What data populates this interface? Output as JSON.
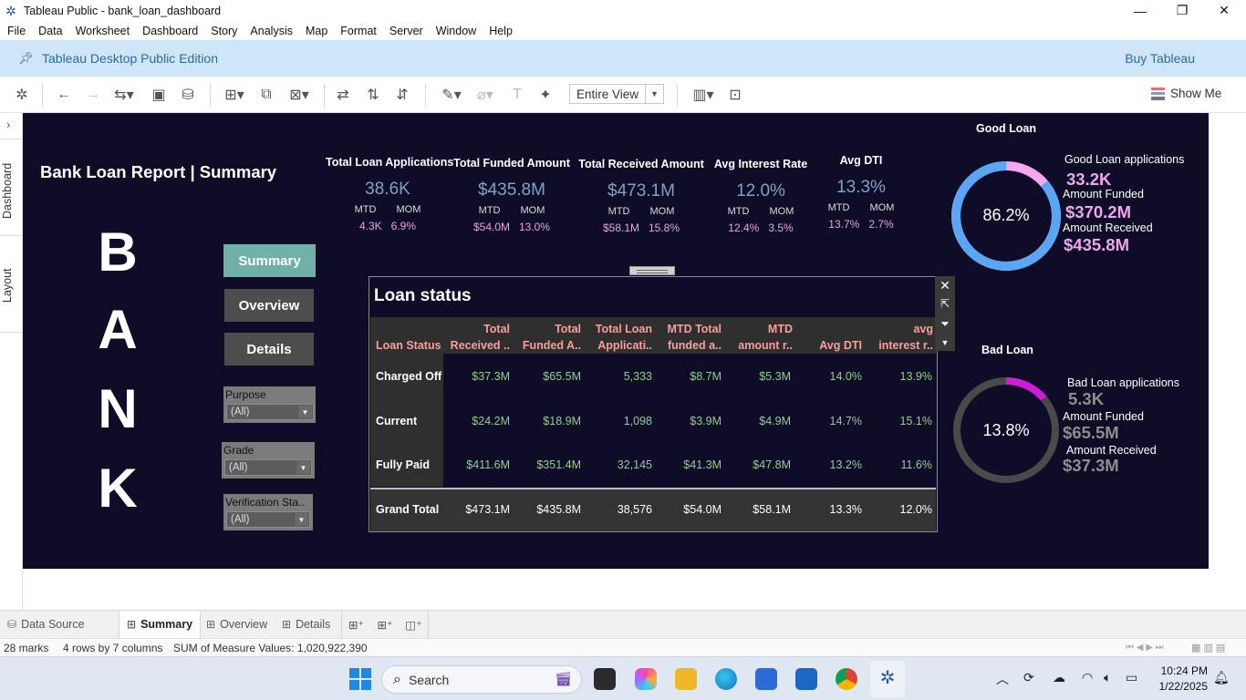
{
  "window": {
    "title": "Tableau Public - bank_loan_dashboard",
    "minimize_icon": "minimize-icon",
    "restore_icon": "restore-icon",
    "close_icon": "close-icon"
  },
  "menu": [
    "File",
    "Data",
    "Worksheet",
    "Dashboard",
    "Story",
    "Analysis",
    "Map",
    "Format",
    "Server",
    "Window",
    "Help"
  ],
  "banner": {
    "text": "Tableau Desktop Public Edition",
    "buy_label": "Buy Tableau"
  },
  "toolbar": {
    "view_select": "Entire View",
    "show_me": "Show Me"
  },
  "side": {
    "dashboard_label": "Dashboard",
    "layout_label": "Layout"
  },
  "dashboard": {
    "title": "Bank Loan Report | Summary",
    "bank_letters": [
      "B",
      "A",
      "N",
      "K"
    ],
    "nav": {
      "summary": "Summary",
      "overview": "Overview",
      "details": "Details"
    },
    "filters": [
      {
        "label": "Purpose",
        "value": "(All)"
      },
      {
        "label": "Grade",
        "value": "(All)"
      },
      {
        "label": "Verification Sta..",
        "value": "(All)"
      }
    ],
    "kpis": [
      {
        "title": "Total Loan Applications",
        "value": "38.6K",
        "mtd_label": "MTD",
        "mom_label": "MOM",
        "mtd": "4.3K",
        "mom": "6.9%"
      },
      {
        "title": "Total Funded Amount",
        "value": "$435.8M",
        "mtd_label": "MTD",
        "mom_label": "MOM",
        "mtd": "$54.0M",
        "mom": "13.0%"
      },
      {
        "title": "Total Received Amount",
        "value": "$473.1M",
        "mtd_label": "MTD",
        "mom_label": "MOM",
        "mtd": "$58.1M",
        "mom": "15.8%"
      },
      {
        "title": "Avg Interest Rate",
        "value": "12.0%",
        "mtd_label": "MTD",
        "mom_label": "MOM",
        "mtd": "12.4%",
        "mom": "3.5%"
      },
      {
        "title": "Avg DTI",
        "value": "13.3%",
        "mtd_label": "MTD",
        "mom_label": "MOM",
        "mtd": "13.7%",
        "mom": "2.7%"
      }
    ],
    "good_loan": {
      "heading": "Good Loan",
      "percent": "86.2%",
      "percent_value": 86.2,
      "applications_label": "Good Loan applications",
      "applications": "33.2K",
      "funded_label": "Amount Funded",
      "funded": "$370.2M",
      "received_label": "Amount Received",
      "received": "$435.8M",
      "color_main": "#5aa6f5",
      "color_rest": "#f7a6f0",
      "value_color": "#f0a6ee"
    },
    "bad_loan": {
      "heading": "Bad Loan",
      "percent": "13.8%",
      "percent_value": 13.8,
      "applications_label": "Bad Loan applications",
      "applications": "5.3K",
      "funded_label": "Amount Funded",
      "funded": "$65.5M",
      "received_label": "Amount Received",
      "received": "$37.3M",
      "color_main": "#d21bd8",
      "color_rest": "#4a4a4a",
      "value_color": "#8e8e8e"
    },
    "loan_status": {
      "title": "Loan status",
      "columns": [
        {
          "line1": "",
          "line2": "Loan Status"
        },
        {
          "line1": "Total",
          "line2": "Received .."
        },
        {
          "line1": "Total",
          "line2": "Funded A.."
        },
        {
          "line1": "Total Loan",
          "line2": "Applicati.."
        },
        {
          "line1": "MTD Total",
          "line2": "funded a.."
        },
        {
          "line1": "MTD",
          "line2": "amount r.."
        },
        {
          "line1": "",
          "line2": "Avg DTI"
        },
        {
          "line1": "avg",
          "line2": "interest r.."
        }
      ],
      "rows": [
        {
          "status": "Charged Off",
          "values": [
            "$37.3M",
            "$65.5M",
            "5,333",
            "$8.7M",
            "$5.3M",
            "14.0%",
            "13.9%"
          ]
        },
        {
          "status": "Current",
          "values": [
            "$24.2M",
            "$18.9M",
            "1,098",
            "$3.9M",
            "$4.9M",
            "14.7%",
            "15.1%"
          ]
        },
        {
          "status": "Fully Paid",
          "values": [
            "$411.6M",
            "$351.4M",
            "32,145",
            "$41.3M",
            "$47.8M",
            "13.2%",
            "11.6%"
          ]
        }
      ],
      "grand_total": {
        "status": "Grand Total",
        "values": [
          "$473.1M",
          "$435.8M",
          "38,576",
          "$54.0M",
          "$58.1M",
          "13.3%",
          "12.0%"
        ]
      }
    }
  },
  "sheet_tabs": {
    "data_source": "Data Source",
    "tabs": [
      "Summary",
      "Overview",
      "Details"
    ]
  },
  "status": {
    "marks": "28 marks",
    "shape": "4 rows by 7 columns",
    "sum": "SUM of Measure Values: 1,020,922,390"
  },
  "taskbar": {
    "search": "Search",
    "time": "10:24 PM",
    "date": "1/22/2025"
  }
}
